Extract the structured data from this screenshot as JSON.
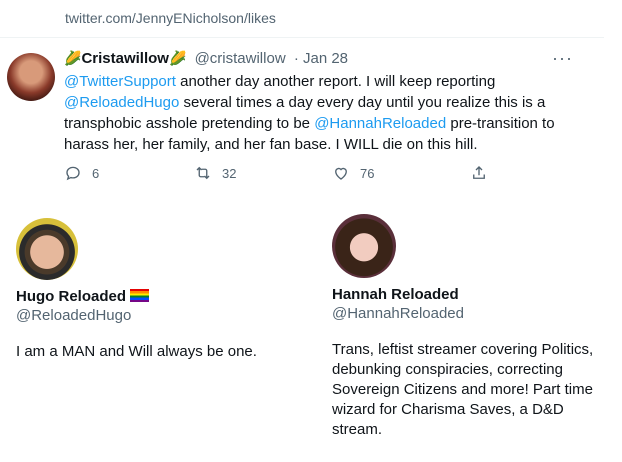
{
  "url": "twitter.com/JennyENicholson/likes",
  "tweet": {
    "leaf_emoji": "🌽",
    "display_name": "Cristawillow",
    "handle": "@cristawillow",
    "date": "· Jan 28",
    "body": [
      {
        "t": "@TwitterSupport",
        "m": true
      },
      {
        "t": " another day another report. I will keep reporting ",
        "m": false
      },
      {
        "t": "@ReloadedHugo",
        "m": true
      },
      {
        "t": " several times a day every day until you realize this is a transphobic asshole pretending to be ",
        "m": false
      },
      {
        "t": "@HannahReloaded",
        "m": true
      },
      {
        "t": " pre-transition to harass her, her family, and her fan base.  I WILL die on this hill.",
        "m": false
      }
    ],
    "replies": "6",
    "retweets": "32",
    "likes": "76"
  },
  "profiles": [
    {
      "name": "Hugo Reloaded",
      "handle": "@ReloadedHugo",
      "bio": "I am a MAN and Will always be one."
    },
    {
      "name": "Hannah Reloaded",
      "handle": "@HannahReloaded",
      "bio": "Trans, leftist streamer covering Politics, debunking conspiracies, correcting Sovereign Citizens and more! Part time wizard for Charisma Saves, a D&D stream."
    }
  ],
  "colors": {
    "mention": "#1d9bf0",
    "muted": "#536471",
    "text": "#0f1419"
  }
}
